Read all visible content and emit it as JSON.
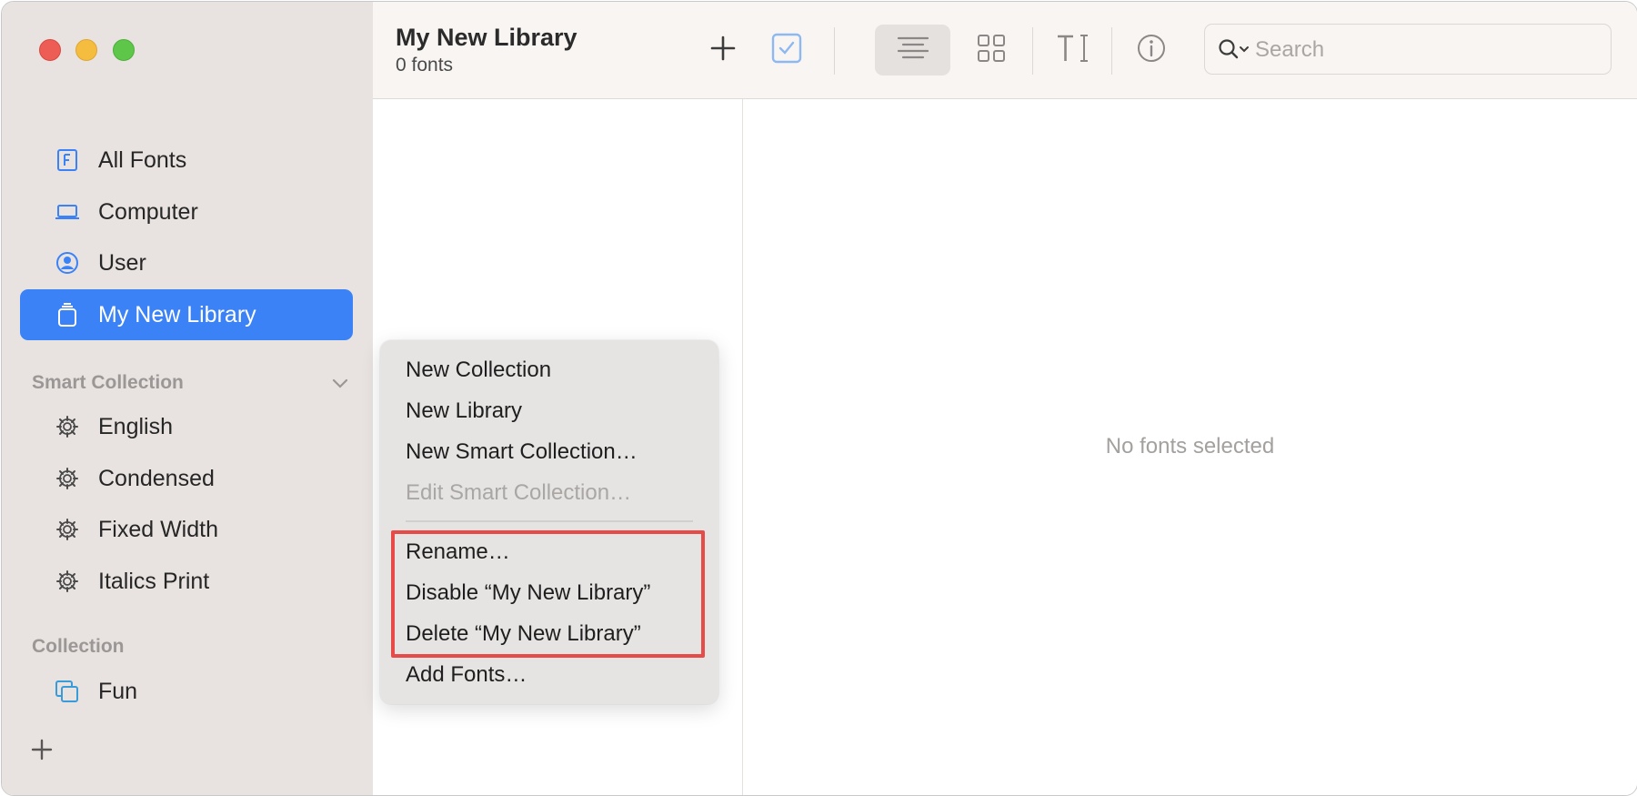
{
  "window": {
    "title": "My New Library",
    "subtitle": "0 fonts"
  },
  "sidebar": {
    "items": [
      {
        "label": "All Fonts",
        "icon": "font-book-icon"
      },
      {
        "label": "Computer",
        "icon": "laptop-icon"
      },
      {
        "label": "User",
        "icon": "user-circle-icon"
      },
      {
        "label": "My New Library",
        "icon": "library-icon",
        "selected": true
      }
    ],
    "smart_collection_label": "Smart Collection",
    "smart_collections": [
      "English",
      "Condensed",
      "Fixed Width",
      "Italics Print"
    ],
    "collection_label": "Collection",
    "collections": [
      "Fun"
    ]
  },
  "toolbar": {
    "search_placeholder": "Search"
  },
  "detail": {
    "empty_text": "No fonts selected"
  },
  "context_menu": {
    "items": [
      {
        "label": "New Collection",
        "enabled": true
      },
      {
        "label": "New Library",
        "enabled": true
      },
      {
        "label": "New Smart Collection…",
        "enabled": true
      },
      {
        "label": "Edit Smart Collection…",
        "enabled": false
      },
      {
        "label": "Rename…",
        "enabled": true
      },
      {
        "label": "Disable “My New Library”",
        "enabled": true
      },
      {
        "label": "Delete “My New Library”",
        "enabled": true
      },
      {
        "label": "Add Fonts…",
        "enabled": true
      }
    ]
  },
  "colors": {
    "accent": "#3b82f6",
    "sidebar_bg": "#e8e3e0",
    "highlight": "#e64b47"
  }
}
